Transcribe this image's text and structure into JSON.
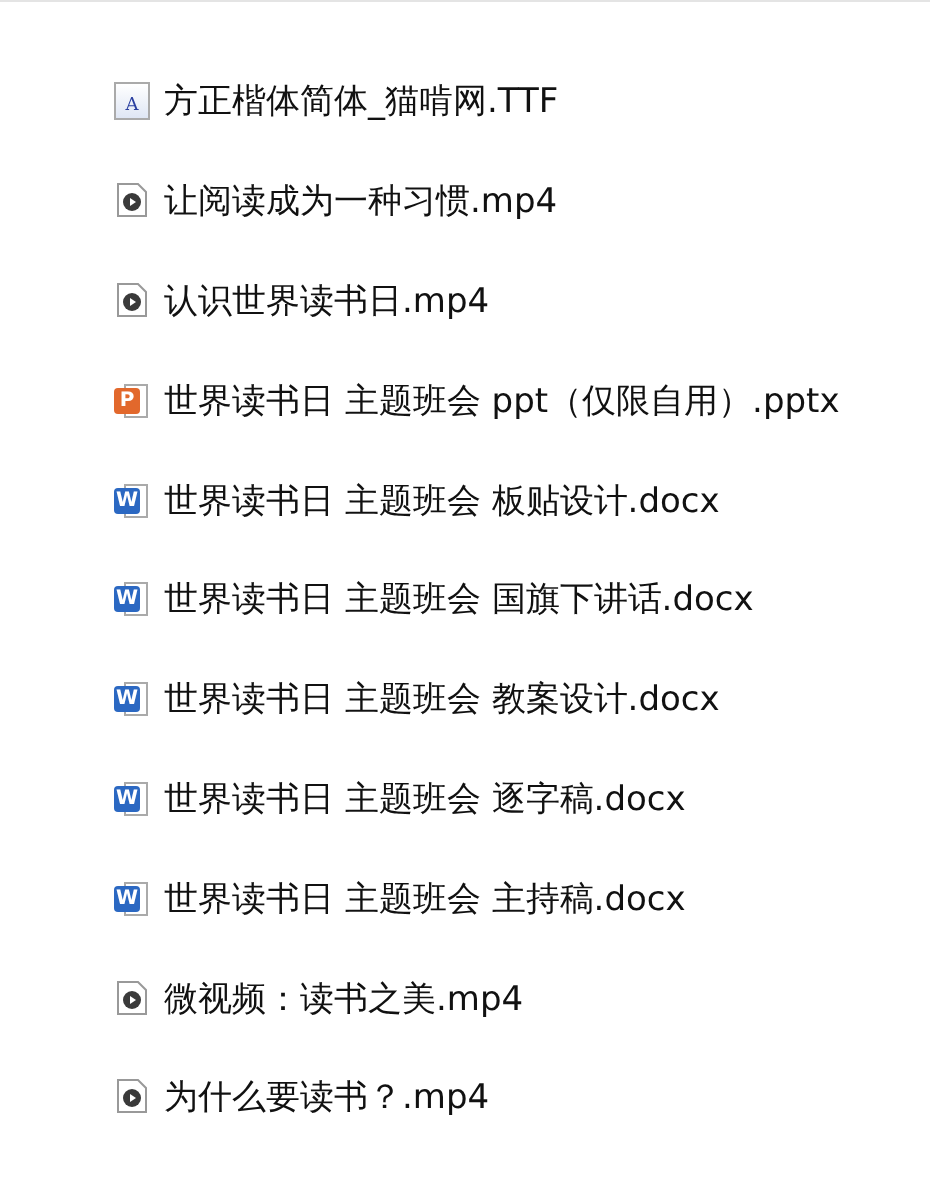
{
  "files": [
    {
      "kind": "font",
      "badge": "A",
      "name": "方正楷体简体_猫啃网.TTF"
    },
    {
      "kind": "video",
      "name": "让阅读成为一种习惯.mp4"
    },
    {
      "kind": "video",
      "name": "认识世界读书日.mp4"
    },
    {
      "kind": "pptx",
      "badge": "P",
      "name": "世界读书日 主题班会 ppt（仅限自用）.pptx"
    },
    {
      "kind": "docx",
      "badge": "W",
      "name": "世界读书日 主题班会 板贴设计.docx"
    },
    {
      "kind": "docx",
      "badge": "W",
      "name": "世界读书日 主题班会 国旗下讲话.docx"
    },
    {
      "kind": "docx",
      "badge": "W",
      "name": "世界读书日 主题班会 教案设计.docx"
    },
    {
      "kind": "docx",
      "badge": "W",
      "name": "世界读书日 主题班会 逐字稿.docx"
    },
    {
      "kind": "docx",
      "badge": "W",
      "name": "世界读书日 主题班会 主持稿.docx"
    },
    {
      "kind": "video",
      "name": "微视频：读书之美.mp4"
    },
    {
      "kind": "video",
      "name": "为什么要读书？.mp4"
    }
  ]
}
